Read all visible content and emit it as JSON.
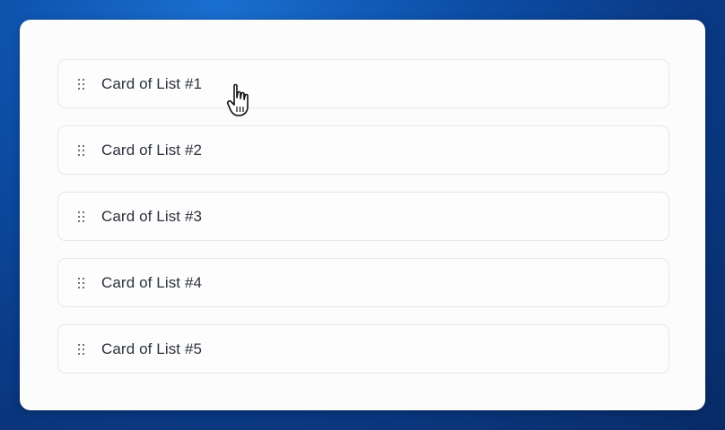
{
  "background": {
    "gradient_colors": [
      "#1a6fd0",
      "#0c4ea6",
      "#0a3a86",
      "#082b66"
    ]
  },
  "panel": {
    "color": "#fcfcfd"
  },
  "list": {
    "handle_icon": "drag-handle-icon",
    "items": [
      {
        "label": "Card of List #1"
      },
      {
        "label": "Card of List #2"
      },
      {
        "label": "Card of List #3"
      },
      {
        "label": "Card of List #4"
      },
      {
        "label": "Card of List #5"
      }
    ]
  },
  "cursor": {
    "icon": "hand-pointer-cursor-icon"
  }
}
